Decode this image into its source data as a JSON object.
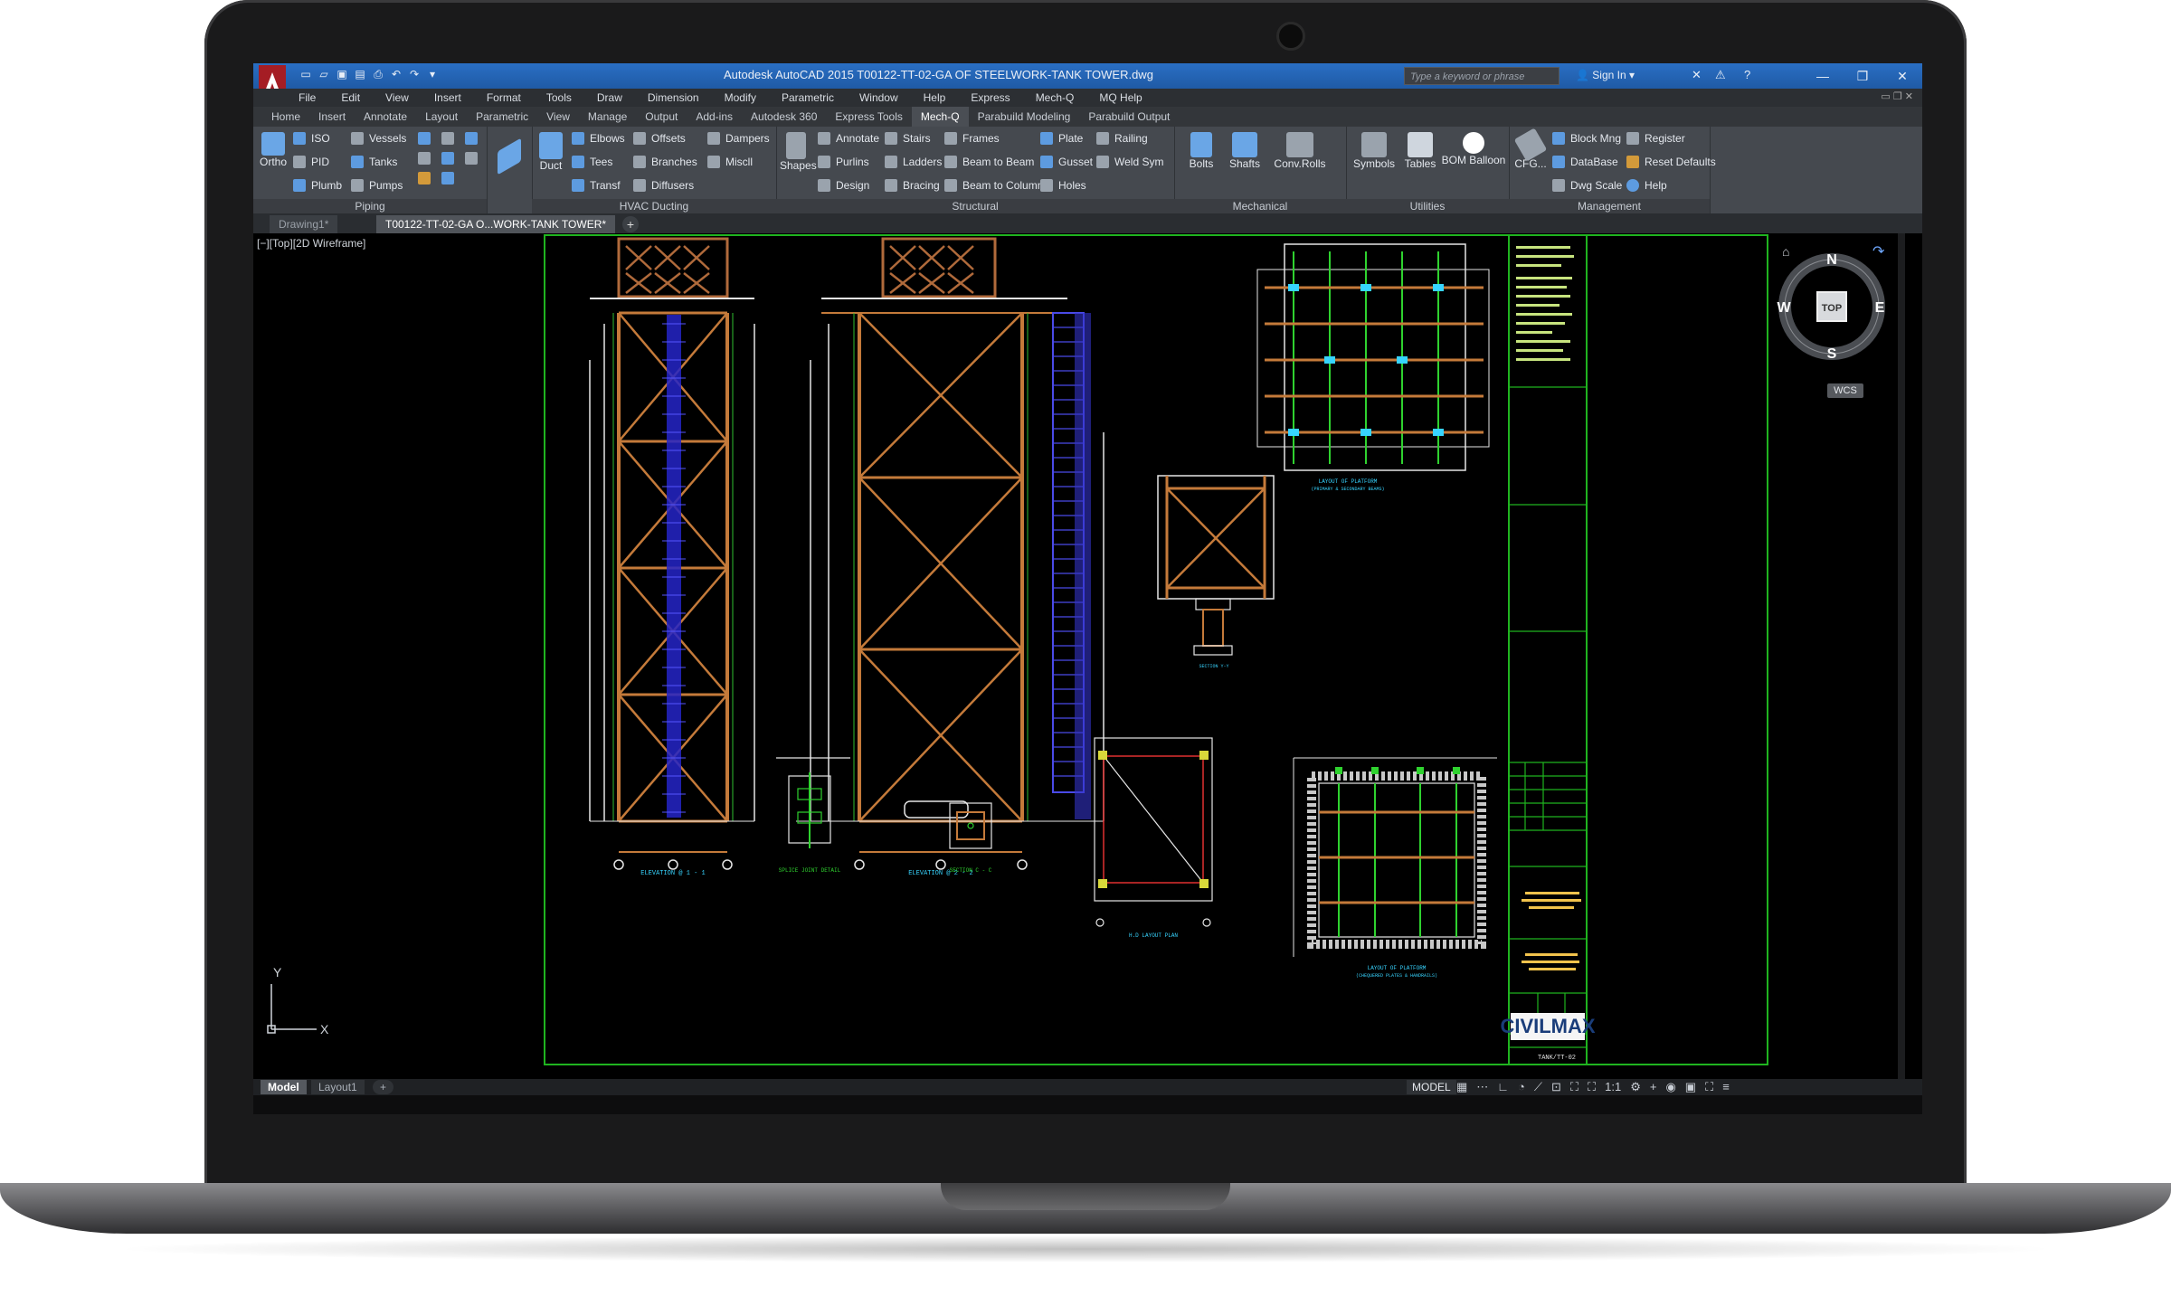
{
  "window": {
    "title": "Autodesk AutoCAD 2015    T00122-TT-02-GA OF STEELWORK-TANK TOWER.dwg",
    "search_placeholder": "Type a keyword or phrase",
    "sign_in": "Sign In"
  },
  "menubar": [
    "File",
    "Edit",
    "View",
    "Insert",
    "Format",
    "Tools",
    "Draw",
    "Dimension",
    "Modify",
    "Parametric",
    "Window",
    "Help",
    "Express",
    "Mech-Q",
    "MQ Help"
  ],
  "ribbon_tabs": [
    "Home",
    "Insert",
    "Annotate",
    "Layout",
    "Parametric",
    "View",
    "Manage",
    "Output",
    "Add-ins",
    "Autodesk 360",
    "Express Tools",
    "Mech-Q",
    "Parabuild Modeling",
    "Parabuild Output"
  ],
  "active_ribbon_tab": "Mech-Q",
  "ribbon": {
    "piping": {
      "title": "Piping",
      "ortho": "Ortho",
      "iso": "ISO",
      "pid": "PID",
      "plumb": "Plumb",
      "vessels": "Vessels",
      "tanks": "Tanks",
      "pumps": "Pumps"
    },
    "hvac": {
      "title": "HVAC Ducting",
      "duct": "Duct",
      "elbows": "Elbows",
      "tees": "Tees",
      "transf": "Transf",
      "offsets": "Offsets",
      "branches": "Branches",
      "diffusers": "Diffusers",
      "dampers": "Dampers",
      "miscll": "Miscll"
    },
    "structural": {
      "title": "Structural",
      "shapes": "Shapes",
      "annotate": "Annotate",
      "purlins": "Purlins",
      "design": "Design",
      "stairs": "Stairs",
      "ladders": "Ladders",
      "bracing": "Bracing",
      "frames": "Frames",
      "beam_to_beam": "Beam to Beam",
      "beam_to_column": "Beam to Column",
      "plate": "Plate",
      "gusset": "Gusset",
      "holes": "Holes",
      "railing": "Railing",
      "weld_sym": "Weld Sym"
    },
    "mechanical": {
      "title": "Mechanical",
      "bolts": "Bolts",
      "shafts": "Shafts",
      "conv_rolls": "Conv.Rolls"
    },
    "utilities": {
      "title": "Utilities",
      "symbols": "Symbols",
      "tables": "Tables",
      "bom_balloon": "BOM Balloon"
    },
    "management": {
      "title": "Management",
      "cfg": "CFG...",
      "block_mng": "Block Mng",
      "database": "DataBase",
      "dwg_scale": "Dwg Scale",
      "register": "Register",
      "reset_defaults": "Reset Defaults",
      "help": "Help"
    }
  },
  "file_tabs": [
    "Drawing1*",
    "T00122-TT-02-GA O...WORK-TANK TOWER*"
  ],
  "viewport_label": "[−][Top][2D Wireframe]",
  "viewcube": {
    "n": "N",
    "s": "S",
    "e": "E",
    "w": "W",
    "top": "TOP",
    "wcs": "WCS"
  },
  "ucs": {
    "x": "X",
    "y": "Y"
  },
  "drawing_labels": {
    "elev1": "ELEVATION @ 1 - 1",
    "elev2": "ELEVATION @ 2 - 2",
    "layout_platform": "LAYOUT OF PLATFORM",
    "layout_platform_sub": "(PRIMARY & SECONDARY BEAMS)",
    "section": "SECTION Y-Y",
    "splice": "SPLICE JOINT DETAIL",
    "section_cc": "SECTION C - C",
    "hd_layout": "H.D LAYOUT PLAN",
    "layout_platform2": "LAYOUT OF PLATFORM",
    "layout_platform2_sub": "(CHEQUERED PLATES & HANDRAILS)",
    "brand": "CIVILMAX",
    "drg_no": "TANK/TT-02"
  },
  "layout_tabs": [
    "Model",
    "Layout1"
  ],
  "status": {
    "model": "MODEL",
    "scale": "1:1"
  }
}
